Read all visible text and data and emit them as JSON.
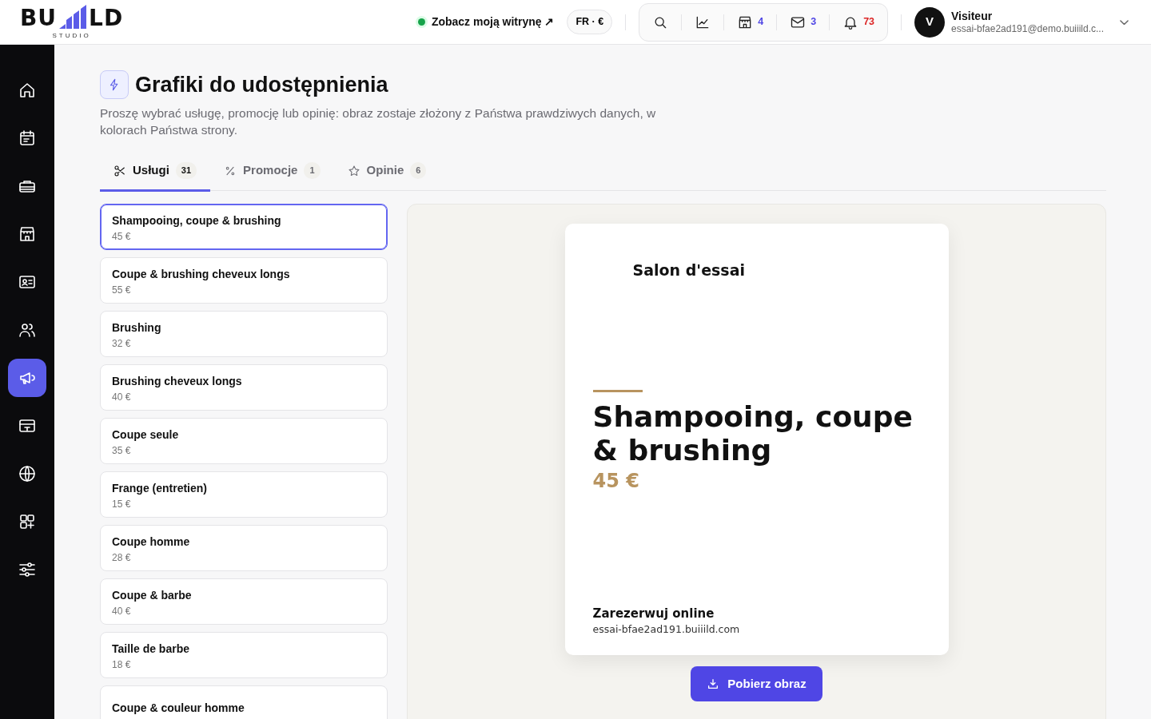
{
  "logo": {
    "left": "BU",
    "right": "LD",
    "tagline": "STUDIO"
  },
  "header": {
    "site_link": "Zobacz moją witrynę ↗",
    "site_online": true,
    "language": "FR",
    "separator": "·",
    "currency": "€",
    "toolbar": [
      {
        "kind": "search"
      },
      {
        "kind": "chart"
      },
      {
        "kind": "store",
        "count": "4",
        "color": "#4f46e5"
      },
      {
        "kind": "mail",
        "count": "3",
        "color": "#4f46e5"
      },
      {
        "kind": "bell",
        "count": "73",
        "color": "#dc2626"
      }
    ],
    "user": {
      "initial": "V",
      "name": "Visiteur",
      "email": "essai-bfae2ad191@demo.buiiild.c..."
    }
  },
  "sidebar": {
    "items": [
      {
        "kind": "home",
        "selected": false
      },
      {
        "kind": "calendar",
        "selected": false
      },
      {
        "kind": "toolbox",
        "selected": false
      },
      {
        "kind": "store",
        "selected": false
      },
      {
        "kind": "idcard",
        "selected": false
      },
      {
        "kind": "users",
        "selected": false
      },
      {
        "kind": "megaphone",
        "selected": true
      },
      {
        "kind": "ticket",
        "selected": false
      },
      {
        "kind": "globe",
        "selected": false
      },
      {
        "kind": "apps",
        "selected": false
      },
      {
        "kind": "sliders",
        "selected": false
      }
    ]
  },
  "page": {
    "title": "Grafiki do udostępnienia",
    "description": "Proszę wybrać usługę, promocję lub opinię: obraz zostaje złożony z Państwa prawdziwych danych, w kolorach Państwa strony."
  },
  "tabs": [
    {
      "kind": "scissors",
      "label": "Usługi",
      "count": "31",
      "selected": true
    },
    {
      "kind": "percent",
      "label": "Promocje",
      "count": "1",
      "selected": false
    },
    {
      "kind": "star",
      "label": "Opinie",
      "count": "6",
      "selected": false
    }
  ],
  "services": [
    {
      "name": "Shampooing, coupe & brushing",
      "price": "45 €",
      "selected": true
    },
    {
      "name": "Coupe & brushing cheveux longs",
      "price": "55 €",
      "selected": false
    },
    {
      "name": "Brushing",
      "price": "32 €",
      "selected": false
    },
    {
      "name": "Brushing cheveux longs",
      "price": "40 €",
      "selected": false
    },
    {
      "name": "Coupe seule",
      "price": "35 €",
      "selected": false
    },
    {
      "name": "Frange (entretien)",
      "price": "15 €",
      "selected": false
    },
    {
      "name": "Coupe homme",
      "price": "28 €",
      "selected": false
    },
    {
      "name": "Coupe & barbe",
      "price": "40 €",
      "selected": false
    },
    {
      "name": "Taille de barbe",
      "price": "18 €",
      "selected": false
    },
    {
      "name": "Coupe & couleur homme",
      "selected": false
    }
  ],
  "preview": {
    "business": "Salon d'essai",
    "title": "Shampooing, coupe & brushing",
    "price": "45 €",
    "cta": "Zarezerwuj online",
    "url": "essai-bfae2ad191.buiiild.com"
  },
  "download_button": "Pobierz obraz"
}
